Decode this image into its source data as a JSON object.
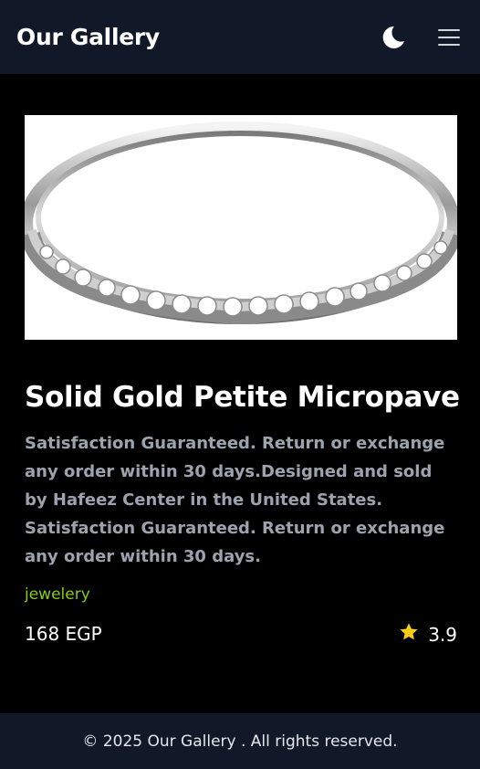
{
  "header": {
    "brand": "Our Gallery",
    "theme_toggle_icon": "moon-icon",
    "menu_icon": "hamburger-menu-icon"
  },
  "product": {
    "image_alt": "ring-image",
    "title": "Solid Gold Petite Micropave",
    "description": "Satisfaction Guaranteed. Return or exchange any order within 30 days.Designed and sold by Hafeez Center in the United States. Satisfaction Guaranteed. Return or exchange any order within 30 days.",
    "category": "jewelery",
    "price": "168 EGP",
    "rating": "3.9",
    "rating_icon": "star-icon"
  },
  "footer": {
    "text": "© 2025 Our Gallery . All rights reserved."
  },
  "colors": {
    "navbar_bg": "#111827",
    "page_bg": "#000000",
    "category": "#84cc16",
    "description": "#9ca3af",
    "star": "#facc15"
  }
}
